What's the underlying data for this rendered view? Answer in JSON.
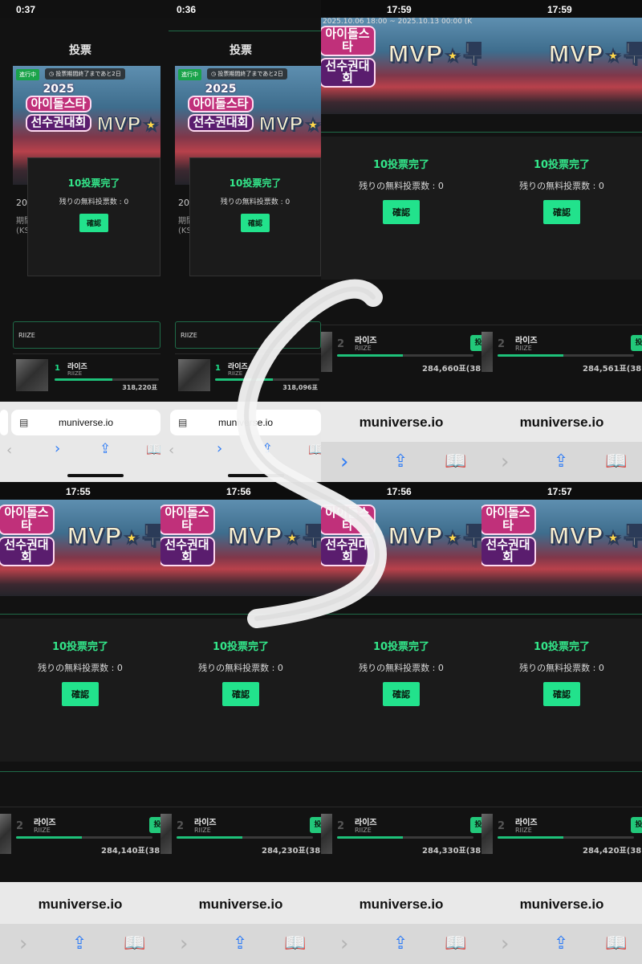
{
  "top_left": {
    "panels": [
      {
        "time": "0:37",
        "votes": "318,220표"
      },
      {
        "time": "0:36",
        "votes": "318,096표"
      }
    ],
    "page_title": "投票",
    "badge": "進行中",
    "period_info": "投票期間終了まであと2日",
    "logo_year": "2025",
    "logo_line1": "아이돌스타",
    "logo_line2": "선수권대회",
    "mvp": "MVP",
    "mvp_suffix": "투",
    "partial_line1": "20",
    "partial_line2": "期間",
    "partial_line3": "(KS",
    "artist_box": "RIIZE",
    "rank": "1",
    "artist_name": "라이즈",
    "artist_group": "RIIZE",
    "url": "muniverse.io"
  },
  "top_right": {
    "panels": [
      {
        "time": "17:59",
        "votes": "284,660표(38"
      },
      {
        "time": "17:59",
        "votes": "284,561표(38"
      }
    ],
    "date_range": "2025.10.06 18:00 ~ 2025.10.13 00:00 (K",
    "url": "muniverse.io"
  },
  "bottom": {
    "panels": [
      {
        "time": "17:55",
        "votes": "284,140표(38"
      },
      {
        "time": "17:56",
        "votes": "284,230표(38"
      },
      {
        "time": "17:56",
        "votes": "284,330표(38"
      },
      {
        "time": "17:57",
        "votes": "284,420표(38"
      }
    ],
    "url": "muniverse.io"
  },
  "dialog": {
    "title": "10投票完了",
    "remaining": "残りの無料投票数 : 0",
    "confirm": "確認"
  },
  "row_common": {
    "rank": "2",
    "artist_name": "라이즈",
    "artist_group": "RIIZE",
    "vote_btn": "投"
  },
  "toolbar_icons": [
    "back-chevron-icon",
    "forward-chevron-icon",
    "share-icon",
    "bookmarks-icon"
  ],
  "colors": {
    "accent_green": "#22e28c",
    "toolbar_blue": "#2f7cf6",
    "dialog_bg": "#1b1b1b"
  }
}
